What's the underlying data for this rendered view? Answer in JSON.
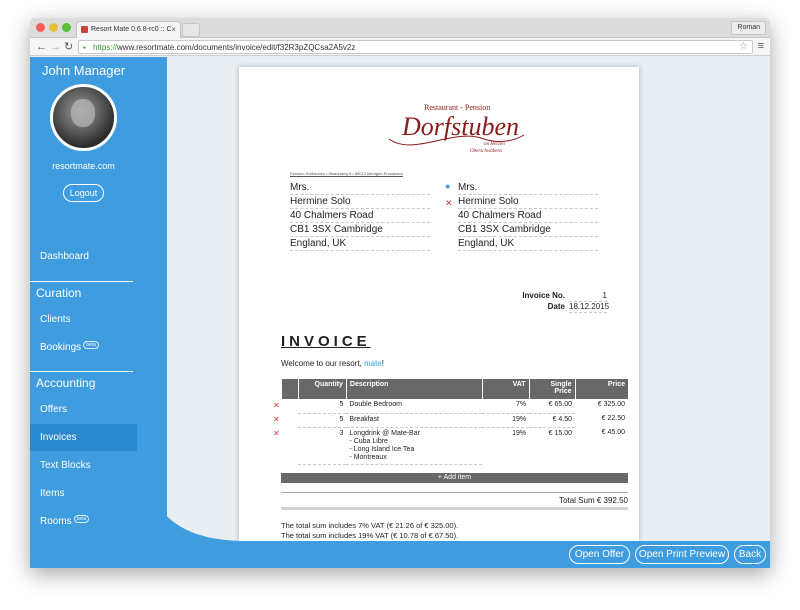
{
  "browser": {
    "tab_title": "Resort Mate 0.6.8-rc0 :: C",
    "tab_close": "×",
    "user": "Roman",
    "url_scheme": "https://",
    "url_rest": "www.resortmate.com/documents/invoice/edit/f32R3pZQCsa2A5v2z"
  },
  "sidebar": {
    "user_name": "John Manager",
    "site": "resortmate.com",
    "logout_label": "Logout",
    "dashboard_label": "Dashboard",
    "curation_title": "Curation",
    "clients_label": "Clients",
    "bookings_label": "Bookings",
    "accounting_title": "Accounting",
    "offers_label": "Offers",
    "invoices_label": "Invoices",
    "text_blocks_label": "Text Blocks",
    "items_label": "Items",
    "rooms_label": "Rooms",
    "beta_label": "beta"
  },
  "document": {
    "logo_top": "Restaurant - Pension",
    "logo_main": "Dorfstuben",
    "logo_sub1": "im Herzen",
    "logo_sub2": "Oberschwabens",
    "sender_line": "Pension Dorfstuben • Alsachweg 6 • 88012 Menigen-Enmabach",
    "address_left": [
      "Mrs.",
      "Hermine Solo",
      "40 Chalmers Road",
      "CB1 3SX Cambridge",
      "England, UK"
    ],
    "address_right": [
      "Mrs.",
      "Hermine Solo",
      "40 Chalmers Road",
      "CB1 3SX Cambridge",
      "England, UK"
    ],
    "invoice_no_label": "Invoice No.",
    "invoice_no": "1",
    "date_label": "Date",
    "date": "18.12.2015",
    "title": "INVOICE",
    "welcome_pre": "Welcome to our resort, ",
    "welcome_name": "mate",
    "welcome_post": "!",
    "columns": {
      "quantity": "Quantity",
      "description": "Description",
      "vat": "VAT",
      "single_price": "Single Price",
      "price": "Price"
    },
    "rows": [
      {
        "qty": "5",
        "desc": "Double Bedroom",
        "vat": "7%",
        "single": "€ 65.00",
        "price": "€ 325.00"
      },
      {
        "qty": "5",
        "desc": "Breakfast",
        "vat": "19%",
        "single": "€ 4.50",
        "price": "€ 22.50"
      },
      {
        "qty": "3",
        "desc": "Longdrink @ Mate-Bar",
        "desc2": "- Cuba Libre",
        "desc3": "- Long Island Ice Tea",
        "desc4": "- Montreaux",
        "vat": "19%",
        "single": "€ 15.00",
        "price": "€ 45.00"
      }
    ],
    "add_item_label": "Add item",
    "total_sum": "Total Sum € 392.50",
    "vat_note_1": "The total sum includes 7% VAT (€ 21.26 of € 325.00).",
    "vat_note_2": "The total sum includes 19% VAT (€ 10.78 of € 67.50)."
  },
  "bottom_bar": {
    "open_offer": "Open Offer",
    "open_print_preview": "Open Print Preview",
    "back": "Back"
  },
  "colors": {
    "accent": "#3f9cdf",
    "active": "#2a88cf",
    "logo": "#8b1a1a",
    "delete": "#d23a3a"
  }
}
